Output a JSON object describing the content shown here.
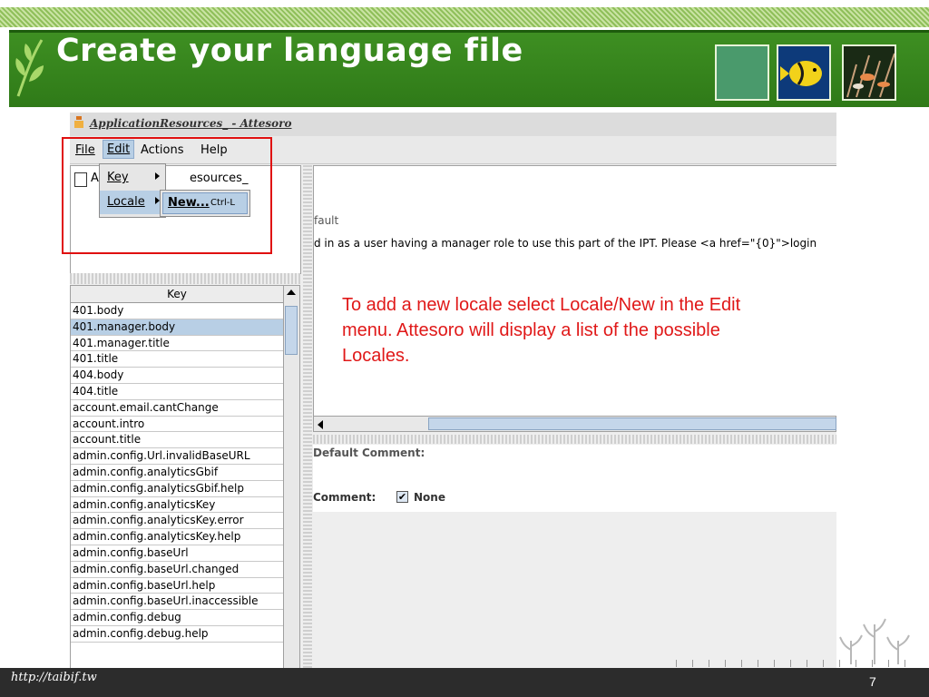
{
  "slide": {
    "title": "Create your language file",
    "url": "http://taibif.tw",
    "page_number": "7",
    "note": "To add a new locale select Locale/New in the Edit menu. Attesoro will display a list of the possible Locales.",
    "colors": {
      "title_bar": "#2f7a18",
      "note_text": "#e01818",
      "highlight_box": "#e01010"
    }
  },
  "app": {
    "window_title": "ApplicationResources_ - Attesoro",
    "menu": {
      "file": "File",
      "edit": "Edit",
      "actions": "Actions",
      "help": "Help"
    },
    "tree": {
      "first_char": "A",
      "suffix": "esources_"
    },
    "edit_menu": {
      "key": "Key",
      "locale": "Locale"
    },
    "locale_submenu": {
      "new": "New...",
      "shortcut": "Ctrl-L"
    },
    "key_table": {
      "header": "Key",
      "selected_row": "401.manager.body",
      "rows": [
        "401.body",
        "401.manager.body",
        "401.manager.title",
        "401.title",
        "404.body",
        "404.title",
        "account.email.cantChange",
        "account.intro",
        "account.title",
        "admin.config.Url.invalidBaseURL",
        "admin.config.analyticsGbif",
        "admin.config.analyticsGbif.help",
        "admin.config.analyticsKey",
        "admin.config.analyticsKey.error",
        "admin.config.analyticsKey.help",
        "admin.config.baseUrl",
        "admin.config.baseUrl.changed",
        "admin.config.baseUrl.help",
        "admin.config.baseUrl.inaccessible",
        "admin.config.debug",
        "admin.config.debug.help"
      ]
    },
    "right_pane": {
      "default_label_fragment": "fault",
      "value_text": "d in as a user having a manager role to use this part of the IPT. Please <a href=\"{0}\">login"
    },
    "comment_pane": {
      "default_comment_label": "Default Comment:",
      "comment_label": "Comment:",
      "none_label": "None",
      "none_checked": true
    }
  }
}
